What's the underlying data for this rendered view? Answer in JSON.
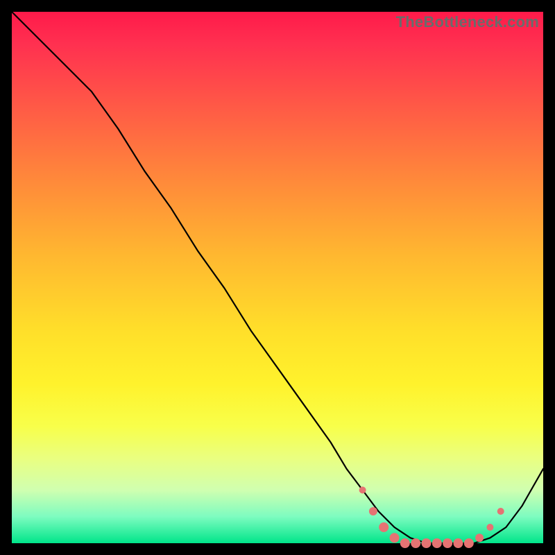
{
  "watermark": "TheBottleneck.com",
  "chart_data": {
    "type": "line",
    "title": "",
    "xlabel": "",
    "ylabel": "",
    "xlim": [
      0,
      100
    ],
    "ylim": [
      0,
      100
    ],
    "grid": false,
    "legend": false,
    "background": "rainbow-gradient-vertical",
    "series": [
      {
        "name": "curve",
        "x": [
          0,
          3,
          6,
          9,
          12,
          15,
          20,
          25,
          30,
          35,
          40,
          45,
          50,
          55,
          60,
          63,
          66,
          69,
          72,
          75,
          78,
          81,
          84,
          87,
          90,
          93,
          96,
          100
        ],
        "y": [
          100,
          97,
          94,
          91,
          88,
          85,
          78,
          70,
          63,
          55,
          48,
          40,
          33,
          26,
          19,
          14,
          10,
          6,
          3,
          1,
          0,
          0,
          0,
          0,
          1,
          3,
          7,
          14
        ]
      }
    ],
    "markers": {
      "name": "trough-dots",
      "color": "#e57373",
      "points": [
        {
          "x": 66,
          "y": 10,
          "r": 5
        },
        {
          "x": 68,
          "y": 6,
          "r": 6
        },
        {
          "x": 70,
          "y": 3,
          "r": 7
        },
        {
          "x": 72,
          "y": 1,
          "r": 7
        },
        {
          "x": 74,
          "y": 0,
          "r": 7
        },
        {
          "x": 76,
          "y": 0,
          "r": 7
        },
        {
          "x": 78,
          "y": 0,
          "r": 7
        },
        {
          "x": 80,
          "y": 0,
          "r": 7
        },
        {
          "x": 82,
          "y": 0,
          "r": 7
        },
        {
          "x": 84,
          "y": 0,
          "r": 7
        },
        {
          "x": 86,
          "y": 0,
          "r": 7
        },
        {
          "x": 88,
          "y": 1,
          "r": 6
        },
        {
          "x": 90,
          "y": 3,
          "r": 5
        },
        {
          "x": 92,
          "y": 6,
          "r": 5
        }
      ]
    }
  }
}
